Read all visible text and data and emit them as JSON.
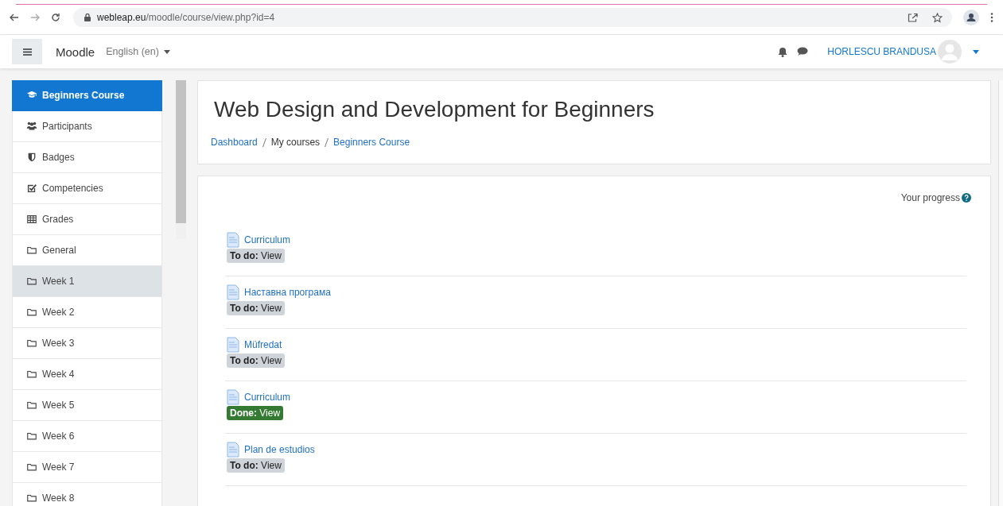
{
  "browser": {
    "url_host": "webleap.eu",
    "url_path": "/moodle/course/view.php?id=4"
  },
  "navbar": {
    "site_name": "Moodle",
    "language": "English (en)",
    "user_name": "HORLESCU BRANDUSA"
  },
  "sidebar": {
    "items": [
      {
        "label": "Beginners Course",
        "kind": "course",
        "selected": true,
        "current": false
      },
      {
        "label": "Participants",
        "kind": "participants",
        "selected": false,
        "current": false
      },
      {
        "label": "Badges",
        "kind": "badges",
        "selected": false,
        "current": false
      },
      {
        "label": "Competencies",
        "kind": "competencies",
        "selected": false,
        "current": false
      },
      {
        "label": "Grades",
        "kind": "grades",
        "selected": false,
        "current": false
      },
      {
        "label": "General",
        "kind": "section",
        "selected": false,
        "current": false
      },
      {
        "label": "Week 1",
        "kind": "section",
        "selected": false,
        "current": true
      },
      {
        "label": "Week 2",
        "kind": "section",
        "selected": false,
        "current": false
      },
      {
        "label": "Week 3",
        "kind": "section",
        "selected": false,
        "current": false
      },
      {
        "label": "Week 4",
        "kind": "section",
        "selected": false,
        "current": false
      },
      {
        "label": "Week 5",
        "kind": "section",
        "selected": false,
        "current": false
      },
      {
        "label": "Week 6",
        "kind": "section",
        "selected": false,
        "current": false
      },
      {
        "label": "Week 7",
        "kind": "section",
        "selected": false,
        "current": false
      },
      {
        "label": "Week 8",
        "kind": "section",
        "selected": false,
        "current": false
      }
    ]
  },
  "header": {
    "title": "Web Design and Development for Beginners",
    "breadcrumb": [
      {
        "label": "Dashboard",
        "link": true
      },
      {
        "label": "My courses",
        "link": false
      },
      {
        "label": "Beginners Course",
        "link": true
      }
    ]
  },
  "content": {
    "progress_label": "Your progress",
    "activities": [
      {
        "name": "Curriculum",
        "status": "**To do:** View",
        "done": false
      },
      {
        "name": "Наставна програма",
        "status": "**To do:** View",
        "done": false
      },
      {
        "name": "Müfredat",
        "status": "**To do:** View",
        "done": false
      },
      {
        "name": "Curriculum",
        "status": "**Done:** View",
        "done": true
      },
      {
        "name": "Plan de estudios",
        "status": "**To do:** View",
        "done": false
      }
    ]
  }
}
